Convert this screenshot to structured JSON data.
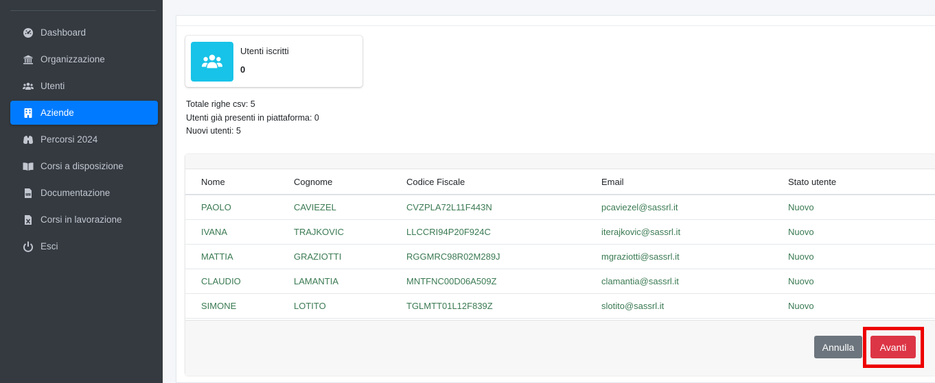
{
  "sidebar": {
    "items": [
      {
        "label": "Dashboard",
        "icon": "dashboard-gauge-icon",
        "active": false
      },
      {
        "label": "Organizzazione",
        "icon": "institution-icon",
        "active": false
      },
      {
        "label": "Utenti",
        "icon": "users-icon",
        "active": false
      },
      {
        "label": "Aziende",
        "icon": "building-icon",
        "active": true
      },
      {
        "label": "Percorsi 2024",
        "icon": "binoculars-icon",
        "active": false
      },
      {
        "label": "Corsi a disposizione",
        "icon": "book-open-icon",
        "active": false
      },
      {
        "label": "Documentazione",
        "icon": "pdf-file-icon",
        "active": false
      },
      {
        "label": "Corsi in lavorazione",
        "icon": "excel-file-icon",
        "active": false
      },
      {
        "label": "Esci",
        "icon": "power-icon",
        "active": false
      }
    ]
  },
  "info_box": {
    "label": "Utenti iscritti",
    "value": "0",
    "icon": "users-icon",
    "color": "#17c3e8"
  },
  "stats": {
    "total_rows": "Totale righe csv: 5",
    "existing_users": "Utenti già presenti in piattaforma: 0",
    "new_users": "Nuovi utenti: 5"
  },
  "table": {
    "headers": [
      "Nome",
      "Cognome",
      "Codice Fiscale",
      "Email",
      "Stato utente"
    ],
    "rows": [
      [
        "PAOLO",
        "CAVIEZEL",
        "CVZPLA72L11F443N",
        "pcaviezel@sassrl.it",
        "Nuovo"
      ],
      [
        "IVANA",
        "TRAJKOVIC",
        "LLCCRI94P20F924C",
        "iterajkovic@sassrl.it",
        "Nuovo"
      ],
      [
        "MATTIA",
        "GRAZIOTTI",
        "RGGMRC98R02M289J",
        "mgraziotti@sassrl.it",
        "Nuovo"
      ],
      [
        "CLAUDIO",
        "LAMANTIA",
        "MNTFNC00D06A509Z",
        "clamantia@sassrl.it",
        "Nuovo"
      ],
      [
        "SIMONE",
        "LOTITO",
        "TGLMTT01L12F839Z",
        "slotito@sassrl.it",
        "Nuovo"
      ]
    ]
  },
  "buttons": {
    "cancel_label": "Annulla",
    "next_label": "Avanti"
  },
  "colors": {
    "sidebar_bg": "#343a40",
    "active_nav": "#007bff",
    "row_text": "#3a7a52",
    "danger": "#dc3545",
    "secondary": "#6c757d",
    "highlight": "#ee0000"
  }
}
